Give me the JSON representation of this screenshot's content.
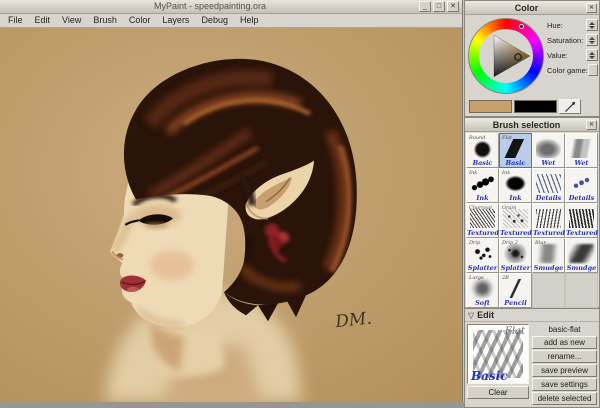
{
  "main_window": {
    "title": "MyPaint - speedpainting.ora",
    "menu": [
      "File",
      "Edit",
      "View",
      "Brush",
      "Color",
      "Layers",
      "Debug",
      "Help"
    ],
    "signature": "DM."
  },
  "icons": {
    "minimize": "_",
    "maximize": "□",
    "close": "✕",
    "panel_close": "✕",
    "expander_open": "▽"
  },
  "color_panel": {
    "title": "Color",
    "hue_label": "Hue:",
    "saturation_label": "Saturation:",
    "value_label": "Value:",
    "color_game_label": "Color game:",
    "current_color": "#c8a06a",
    "secondary_color": "#000000"
  },
  "brush_panel": {
    "title": "Brush selection",
    "items": [
      {
        "corner": "Round",
        "label": "Basic",
        "glyph": "round",
        "selected": false
      },
      {
        "corner": "Flat",
        "label": "Basic",
        "glyph": "flat",
        "selected": true
      },
      {
        "corner": "",
        "label": "Wet",
        "glyph": "wet",
        "selected": false
      },
      {
        "corner": "",
        "label": "Wet",
        "glyph": "wet2",
        "selected": false
      },
      {
        "corner": "Ink",
        "label": "Ink",
        "glyph": "ink",
        "selected": false
      },
      {
        "corner": "Ink",
        "label": "Ink",
        "glyph": "ink2",
        "selected": false
      },
      {
        "corner": "",
        "label": "Details",
        "glyph": "details",
        "selected": false
      },
      {
        "corner": "",
        "label": "Details",
        "glyph": "details2",
        "selected": false
      },
      {
        "corner": "Charcoal",
        "label": "Textured",
        "glyph": "charcoal",
        "selected": false
      },
      {
        "corner": "Grain",
        "label": "Textured",
        "glyph": "grain",
        "selected": false
      },
      {
        "corner": "",
        "label": "Textured",
        "glyph": "scratch",
        "selected": false
      },
      {
        "corner": "",
        "label": "Textured",
        "glyph": "scratch2",
        "selected": false
      },
      {
        "corner": "Drip",
        "label": "Splatter",
        "glyph": "splatter",
        "selected": false
      },
      {
        "corner": "Drip 2",
        "label": "Splatter",
        "glyph": "spray",
        "selected": false
      },
      {
        "corner": "Blur",
        "label": "Smudge",
        "glyph": "smudge",
        "selected": false
      },
      {
        "corner": "",
        "label": "Smudge",
        "glyph": "smudge2",
        "selected": false
      },
      {
        "corner": "Large",
        "label": "Soft",
        "glyph": "soft",
        "selected": false
      },
      {
        "corner": "2B",
        "label": "Pencil",
        "glyph": "pencil",
        "selected": false
      }
    ]
  },
  "edit_panel": {
    "title": "Edit",
    "preview_corner": "Flat",
    "preview_label": "Basic",
    "clear_label": "Clear",
    "name_label": "basic-flat",
    "buttons": [
      "add as new",
      "rename...",
      "save preview",
      "save settings",
      "delete selected"
    ]
  }
}
